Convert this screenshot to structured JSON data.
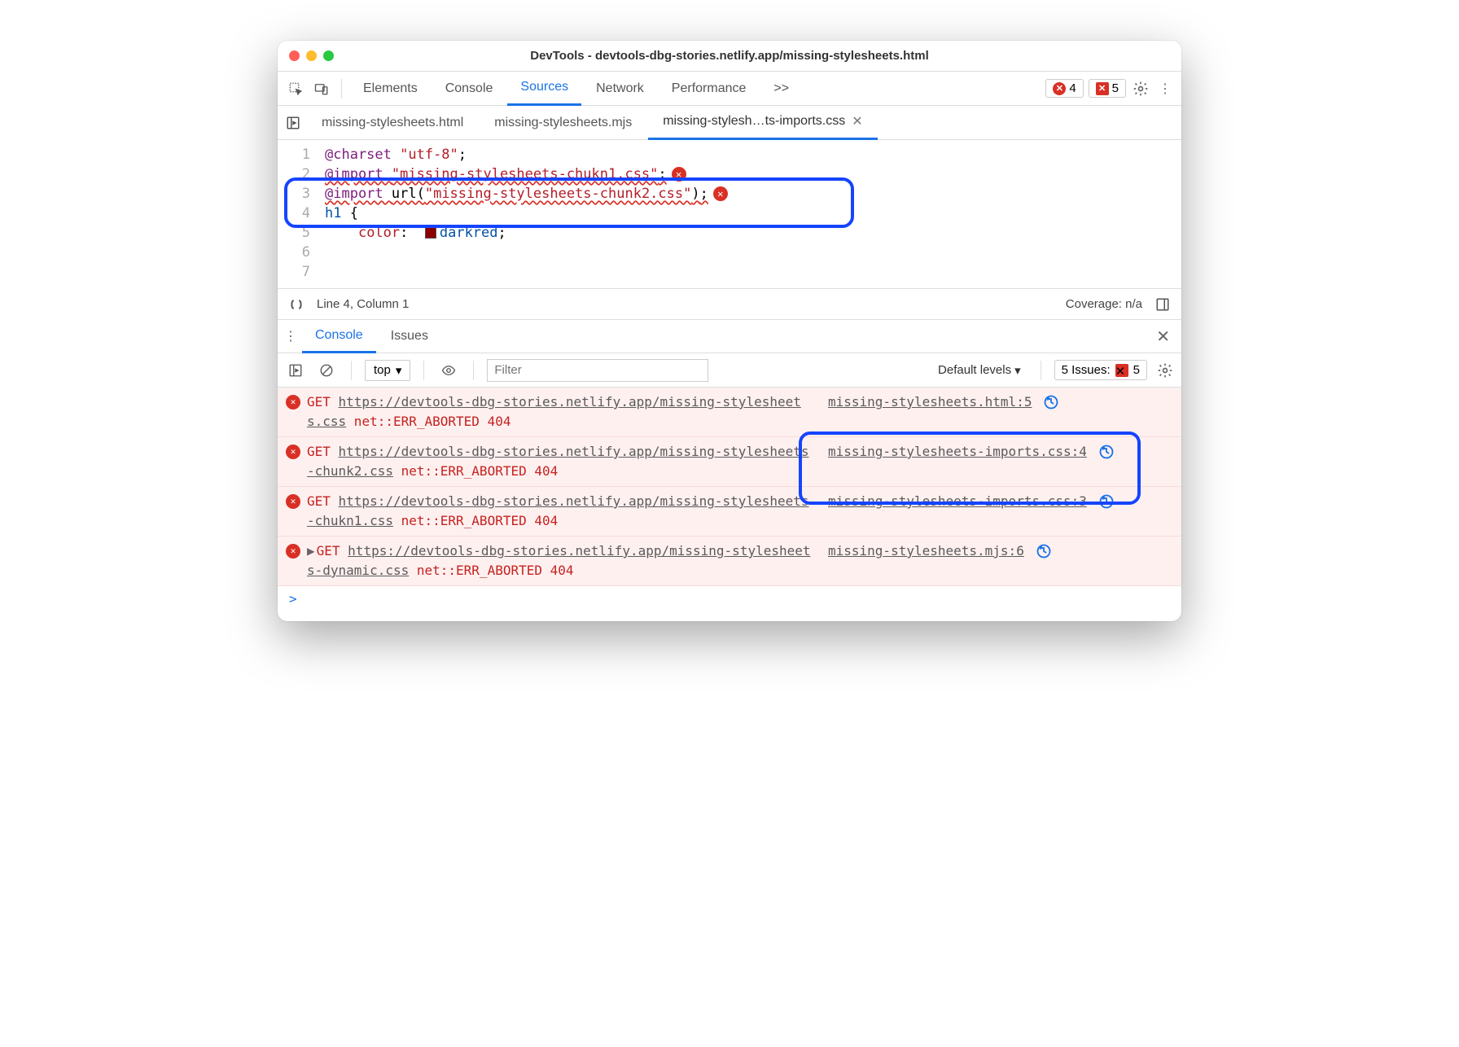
{
  "window": {
    "title": "DevTools - devtools-dbg-stories.netlify.app/missing-stylesheets.html"
  },
  "toolbar": {
    "tabs": [
      "Elements",
      "Console",
      "Sources",
      "Network",
      "Performance"
    ],
    "activeTab": "Sources",
    "overflow": ">>",
    "errorCount": "4",
    "warnCount": "5"
  },
  "fileTabs": {
    "items": [
      {
        "label": "missing-stylesheets.html"
      },
      {
        "label": "missing-stylesheets.mjs"
      },
      {
        "label": "missing-stylesh…ts-imports.css"
      }
    ],
    "activeIndex": 2
  },
  "editor": {
    "lines": [
      {
        "n": "1",
        "parts": [
          {
            "t": "@charset ",
            "c": "kw"
          },
          {
            "t": "\"utf-8\"",
            "c": "str"
          },
          {
            "t": ";",
            "c": ""
          }
        ]
      },
      {
        "n": "2",
        "parts": []
      },
      {
        "n": "3",
        "parts": [
          {
            "t": "@import ",
            "c": "kw squig"
          },
          {
            "t": "\"missing-stylesheets-chukn1.css\"",
            "c": "str squig"
          },
          {
            "t": ";",
            "c": "squig"
          }
        ],
        "err": true
      },
      {
        "n": "4",
        "parts": [
          {
            "t": "@import ",
            "c": "kw squig"
          },
          {
            "t": "url(",
            "c": "squig"
          },
          {
            "t": "\"missing-stylesheets-chunk2.css\"",
            "c": "str squig"
          },
          {
            "t": ")",
            "c": "squig"
          },
          {
            "t": ";",
            "c": "squig"
          }
        ],
        "err": true
      },
      {
        "n": "5",
        "parts": []
      },
      {
        "n": "6",
        "parts": [
          {
            "t": "h1 ",
            "c": "val"
          },
          {
            "t": "{",
            "c": ""
          }
        ]
      },
      {
        "n": "7",
        "parts": [
          {
            "t": "    ",
            "c": ""
          },
          {
            "t": "color",
            "c": "str"
          },
          {
            "t": ":  ",
            "c": ""
          },
          {
            "sw": true
          },
          {
            "t": "darkred",
            "c": "val"
          },
          {
            "t": ";",
            "c": ""
          }
        ]
      }
    ]
  },
  "status": {
    "pos": "Line 4, Column 1",
    "coverage": "Coverage: n/a"
  },
  "drawer": {
    "tabs": [
      "Console",
      "Issues"
    ],
    "activeIndex": 0
  },
  "consoleToolbar": {
    "context": "top",
    "filterPlaceholder": "Filter",
    "levels": "Default levels",
    "issuesLabel": "5 Issues:",
    "issuesCount": "5"
  },
  "consoleMsgs": [
    {
      "text": "GET ",
      "url": "https://devtools-dbg-stories.netlify.app/missing-stylesheets.css",
      "suffix": " net::ERR_ABORTED 404",
      "source": "missing-stylesheets.html:5",
      "expand": false
    },
    {
      "text": "GET ",
      "url": "https://devtools-dbg-stories.netlify.app/missing-stylesheets-chunk2.css",
      "suffix": " net::ERR_ABORTED 404",
      "source": "missing-stylesheets-imports.css:4",
      "expand": false
    },
    {
      "text": "GET ",
      "url": "https://devtools-dbg-stories.netlify.app/missing-stylesheets-chukn1.css",
      "suffix": " net::ERR_ABORTED 404",
      "source": "missing-stylesheets-imports.css:3",
      "expand": false
    },
    {
      "text": "GET ",
      "url": "https://devtools-dbg-stories.netlify.app/missing-stylesheets-dynamic.css",
      "suffix": " net::ERR_ABORTED 404",
      "source": "missing-stylesheets.mjs:6",
      "expand": true
    }
  ]
}
